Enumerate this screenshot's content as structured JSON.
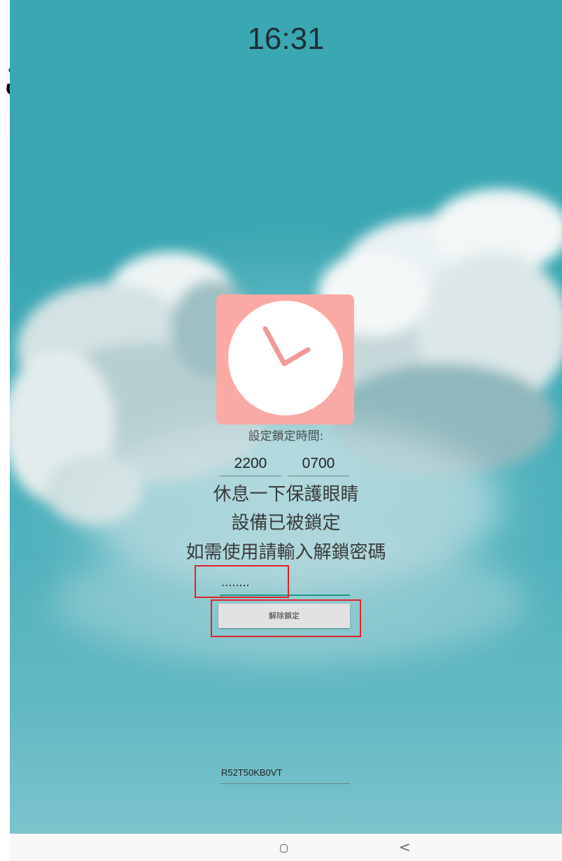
{
  "status_bar": {
    "time": "16:31"
  },
  "lock_screen": {
    "set_time_label": "設定鎖定時間:",
    "start_time": "2200",
    "end_time": "0700",
    "messages": [
      "休息一下保護眼睛",
      "設備已被鎖定",
      "如需使用請輸入解鎖密碼"
    ],
    "password_masked": "........",
    "unlock_button_label": "解除鎖定",
    "device_id": "R52T50KB0VT"
  },
  "nav_bar": {
    "home_icon": "home-icon",
    "back_icon": "back-icon",
    "back_glyph": "<"
  },
  "icons": {
    "app_icon": "clock-icon"
  },
  "colors": {
    "sky": "#3aa7b3",
    "icon_bg": "#fba9a4",
    "clock_hands": "#f19a9a",
    "field_accent": "#1b9a8a",
    "highlight": "#e0242a"
  }
}
